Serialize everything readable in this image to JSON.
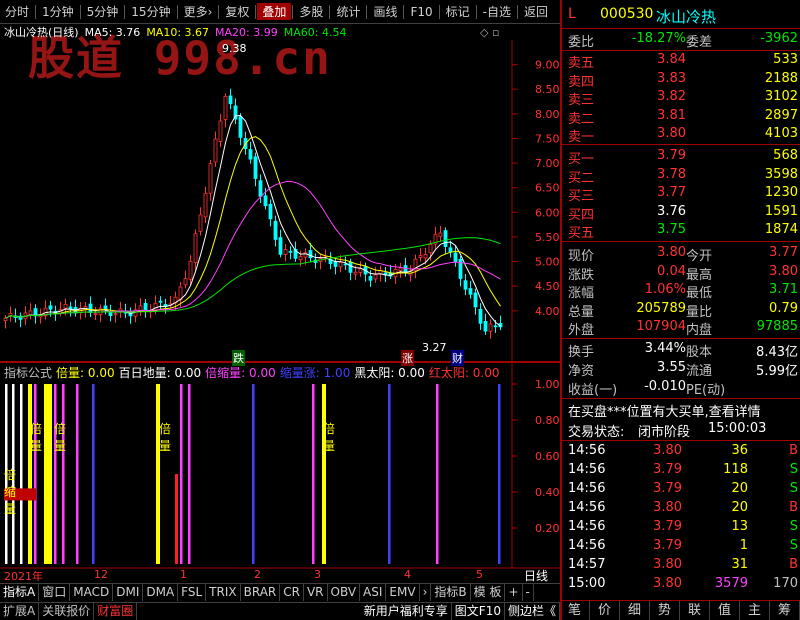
{
  "toolbar": {
    "items": [
      "分时",
      "1分钟",
      "5分钟",
      "15分钟",
      "更多›",
      "复权",
      "叠加",
      "多股",
      "统计",
      "画线",
      "F10",
      "标记",
      "-自选",
      "返回"
    ],
    "active": "叠加"
  },
  "chart": {
    "title": "冰山冷热(日线)",
    "ma5": "MA5: 3.76",
    "ma10": "MA10: 3.67",
    "ma20": "MA20: 3.99",
    "ma60": "MA60: 4.54",
    "watermark": "股道 998.cn",
    "high_note": "9.38",
    "low_note": "3.27",
    "tag_die": "跌",
    "tag_zhang": "涨",
    "tag_cai": "财",
    "y_ticks": [
      "9.00",
      "8.50",
      "8.00",
      "7.50",
      "7.00",
      "6.50",
      "6.00",
      "5.50",
      "5.00",
      "4.50",
      "4.00"
    ],
    "colors": {
      "ma5": "#ffffff",
      "ma10": "#ffff00",
      "ma20": "#ff40ff",
      "ma60": "#00e600",
      "up": "#ff3232",
      "down": "#00ffff"
    }
  },
  "indicator": {
    "name": "指标公式",
    "labels": [
      {
        "text": "倍量: 0.00",
        "color": "#ffff00"
      },
      {
        "text": "百日地量: 0.00",
        "color": "#ffffff"
      },
      {
        "text": "倍缩量: 0.00",
        "color": "#ff40ff"
      },
      {
        "text": "缩量涨: 1.00",
        "color": "#4040ff"
      },
      {
        "text": "黑太阳: 0.00",
        "color": "#ffffff"
      },
      {
        "text": "红太阳: 0.00",
        "color": "#ff3232"
      }
    ],
    "y_ticks": [
      "1.00",
      "0.80",
      "0.60",
      "0.40",
      "0.20"
    ],
    "bar_labels": [
      "倍量",
      "倍量",
      "倍量",
      "倍量",
      "倍量"
    ],
    "left_label": "倍缩量"
  },
  "time_axis": [
    "2021年",
    "12",
    "1",
    "2",
    "3",
    "4",
    "5"
  ],
  "axis_label": "日线",
  "tabs_row1": [
    "指标A",
    "窗口",
    "MACD",
    "DMI",
    "DMA",
    "FSL",
    "TRIX",
    "BRAR",
    "CR",
    "VR",
    "OBV",
    "ASI",
    "EMV",
    "›",
    "指标B",
    "模 板",
    "+",
    "-"
  ],
  "tabs_row2": [
    "扩展A",
    "关联报价",
    "财富圈"
  ],
  "tabs_row2_right": [
    "新用户福利专享",
    "图文F10",
    "侧边栏《"
  ],
  "quote": {
    "flag": "L",
    "code": "000530",
    "name": "冰山冷热",
    "weibi_label": "委比",
    "weibi": "-18.27%",
    "weicha_label": "委差",
    "weicha": "-3962",
    "asks": [
      {
        "label": "卖五",
        "price": "3.84",
        "vol": "533"
      },
      {
        "label": "卖四",
        "price": "3.83",
        "vol": "2188"
      },
      {
        "label": "卖三",
        "price": "3.82",
        "vol": "3102"
      },
      {
        "label": "卖二",
        "price": "3.81",
        "vol": "2897"
      },
      {
        "label": "卖一",
        "price": "3.80",
        "vol": "4103"
      }
    ],
    "bids": [
      {
        "label": "买一",
        "price": "3.79",
        "vol": "568",
        "c": "red"
      },
      {
        "label": "买二",
        "price": "3.78",
        "vol": "3598",
        "c": "red"
      },
      {
        "label": "买三",
        "price": "3.77",
        "vol": "1230",
        "c": "red"
      },
      {
        "label": "买四",
        "price": "3.76",
        "vol": "1591",
        "c": "wht"
      },
      {
        "label": "买五",
        "price": "3.75",
        "vol": "1874",
        "c": "grn"
      }
    ],
    "stats": [
      {
        "l1": "现价",
        "v1": "3.80",
        "c1": "red",
        "l2": "今开",
        "v2": "3.77",
        "c2": "red"
      },
      {
        "l1": "涨跌",
        "v1": "0.04",
        "c1": "red",
        "l2": "最高",
        "v2": "3.80",
        "c2": "red"
      },
      {
        "l1": "涨幅",
        "v1": "1.06%",
        "c1": "red",
        "l2": "最低",
        "v2": "3.71",
        "c2": "grn"
      },
      {
        "l1": "总量",
        "v1": "205789",
        "c1": "yel",
        "l2": "量比",
        "v2": "0.79",
        "c2": "yel"
      },
      {
        "l1": "外盘",
        "v1": "107904",
        "c1": "red",
        "l2": "内盘",
        "v2": "97885",
        "c2": "grn"
      }
    ],
    "stats2": [
      {
        "l1": "换手",
        "v1": "3.44%",
        "l2": "股本",
        "v2": "8.43亿"
      },
      {
        "l1": "净资",
        "v1": "3.55",
        "l2": "流通",
        "v2": "5.99亿"
      },
      {
        "l1": "收益(一)",
        "v1": "-0.010",
        "l2": "PE(动)",
        "v2": ""
      }
    ],
    "notice": "在买盘***位置有大买单,查看详情",
    "status_label": "交易状态:",
    "status": "闭市阶段",
    "status_time": "15:00:03",
    "ticks": [
      {
        "t": "14:56",
        "p": "3.80",
        "pc": "red",
        "v": "36",
        "vc": "yel",
        "s": "B",
        "sc": "red"
      },
      {
        "t": "14:56",
        "p": "3.79",
        "pc": "red",
        "v": "118",
        "vc": "yel",
        "s": "S",
        "sc": "grn"
      },
      {
        "t": "14:56",
        "p": "3.79",
        "pc": "red",
        "v": "20",
        "vc": "yel",
        "s": "S",
        "sc": "grn"
      },
      {
        "t": "14:56",
        "p": "3.80",
        "pc": "red",
        "v": "20",
        "vc": "yel",
        "s": "B",
        "sc": "red"
      },
      {
        "t": "14:56",
        "p": "3.79",
        "pc": "red",
        "v": "13",
        "vc": "yel",
        "s": "S",
        "sc": "grn"
      },
      {
        "t": "14:56",
        "p": "3.79",
        "pc": "red",
        "v": "1",
        "vc": "yel",
        "s": "S",
        "sc": "grn"
      },
      {
        "t": "14:57",
        "p": "3.80",
        "pc": "red",
        "v": "31",
        "vc": "yel",
        "s": "B",
        "sc": "red"
      },
      {
        "t": "15:00",
        "p": "3.80",
        "pc": "red",
        "v": "3579",
        "vc": "mag",
        "s": "170",
        "sc": "gry"
      }
    ],
    "bottom_tabs": [
      "笔",
      "价",
      "细",
      "势",
      "联",
      "值",
      "主",
      "筹"
    ]
  }
}
